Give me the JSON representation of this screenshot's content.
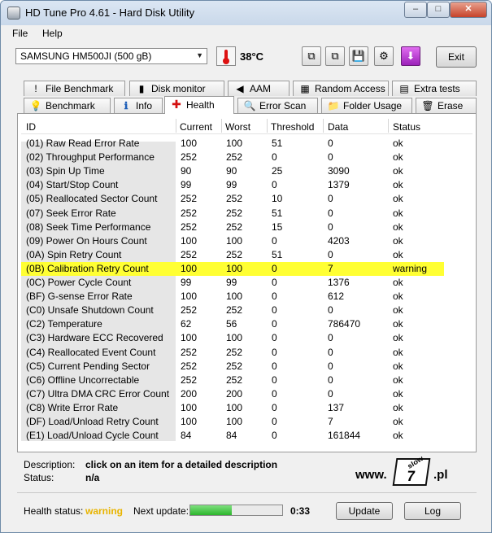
{
  "window": {
    "title": "HD Tune Pro 4.61 - Hard Disk Utility",
    "min": "–",
    "max": "□",
    "close": "✕"
  },
  "menu": {
    "file": "File",
    "help": "Help"
  },
  "toolbar": {
    "drive": "SAMSUNG HM500JI (500 gB)",
    "temperature": "38°C",
    "exit": "Exit",
    "icons": [
      "copy-icon",
      "copy-info-icon",
      "save-icon",
      "options-icon",
      "download-icon"
    ]
  },
  "tabs_top": [
    {
      "label": "File Benchmark",
      "icon": "file-benchmark-icon",
      "glyph": "!"
    },
    {
      "label": "Disk monitor",
      "icon": "disk-monitor-icon",
      "glyph": "▮"
    },
    {
      "label": "AAM",
      "icon": "speaker-icon",
      "glyph": "◀"
    },
    {
      "label": "Random Access",
      "icon": "random-access-icon",
      "glyph": "▦"
    },
    {
      "label": "Extra tests",
      "icon": "extra-tests-icon",
      "glyph": "▤"
    }
  ],
  "tabs_bottom": [
    {
      "label": "Benchmark",
      "icon": "benchmark-icon",
      "glyph": "💡"
    },
    {
      "label": "Info",
      "icon": "info-icon",
      "glyph": "ℹ"
    },
    {
      "label": "Health",
      "icon": "health-cross-icon",
      "glyph": "✚"
    },
    {
      "label": "Error Scan",
      "icon": "error-scan-icon",
      "glyph": "🔍"
    },
    {
      "label": "Folder Usage",
      "icon": "folder-icon",
      "glyph": "📁"
    },
    {
      "label": "Erase",
      "icon": "erase-icon",
      "glyph": "🗑"
    }
  ],
  "table": {
    "columns": [
      "ID",
      "Current",
      "Worst",
      "Threshold",
      "Data",
      "Status"
    ],
    "rows": [
      [
        "(01) Raw Read Error Rate",
        "100",
        "100",
        "51",
        "0",
        "ok"
      ],
      [
        "(02) Throughput Performance",
        "252",
        "252",
        "0",
        "0",
        "ok"
      ],
      [
        "(03) Spin Up Time",
        "90",
        "90",
        "25",
        "3090",
        "ok"
      ],
      [
        "(04) Start/Stop Count",
        "99",
        "99",
        "0",
        "1379",
        "ok"
      ],
      [
        "(05) Reallocated Sector Count",
        "252",
        "252",
        "10",
        "0",
        "ok"
      ],
      [
        "(07) Seek Error Rate",
        "252",
        "252",
        "51",
        "0",
        "ok"
      ],
      [
        "(08) Seek Time Performance",
        "252",
        "252",
        "15",
        "0",
        "ok"
      ],
      [
        "(09) Power On Hours Count",
        "100",
        "100",
        "0",
        "4203",
        "ok"
      ],
      [
        "(0A) Spin Retry Count",
        "252",
        "252",
        "51",
        "0",
        "ok"
      ],
      [
        "(0B) Calibration Retry Count",
        "100",
        "100",
        "0",
        "7",
        "warning"
      ],
      [
        "(0C) Power Cycle Count",
        "99",
        "99",
        "0",
        "1376",
        "ok"
      ],
      [
        "(BF) G-sense Error Rate",
        "100",
        "100",
        "0",
        "612",
        "ok"
      ],
      [
        "(C0) Unsafe Shutdown Count",
        "252",
        "252",
        "0",
        "0",
        "ok"
      ],
      [
        "(C2) Temperature",
        "62",
        "56",
        "0",
        "786470",
        "ok"
      ],
      [
        "(C3) Hardware ECC Recovered",
        "100",
        "100",
        "0",
        "0",
        "ok"
      ],
      [
        "(C4) Reallocated Event Count",
        "252",
        "252",
        "0",
        "0",
        "ok"
      ],
      [
        "(C5) Current Pending Sector",
        "252",
        "252",
        "0",
        "0",
        "ok"
      ],
      [
        "(C6) Offline Uncorrectable",
        "252",
        "252",
        "0",
        "0",
        "ok"
      ],
      [
        "(C7) Ultra DMA CRC Error Count",
        "200",
        "200",
        "0",
        "0",
        "ok"
      ],
      [
        "(C8) Write Error Rate",
        "100",
        "100",
        "0",
        "137",
        "ok"
      ],
      [
        "(DF) Load/Unload Retry Count",
        "100",
        "100",
        "0",
        "7",
        "ok"
      ],
      [
        "(E1) Load/Unload Cycle Count",
        "84",
        "84",
        "0",
        "161844",
        "ok"
      ]
    ],
    "highlight_color": "#ffff33"
  },
  "details": {
    "description_label": "Description:",
    "description_value": "click on an item for a detailed description",
    "status_label": "Status:",
    "status_value": "n/a"
  },
  "logo": {
    "prefix": "www.",
    "slash": "slow",
    "digit": "7",
    "suffix": ".pl"
  },
  "footer": {
    "health_label": "Health status:",
    "health_value": "warning",
    "health_color": "#e8b400",
    "next_update_label": "Next update:",
    "progress": 0.45,
    "countdown": "0:33",
    "update": "Update",
    "log": "Log"
  }
}
